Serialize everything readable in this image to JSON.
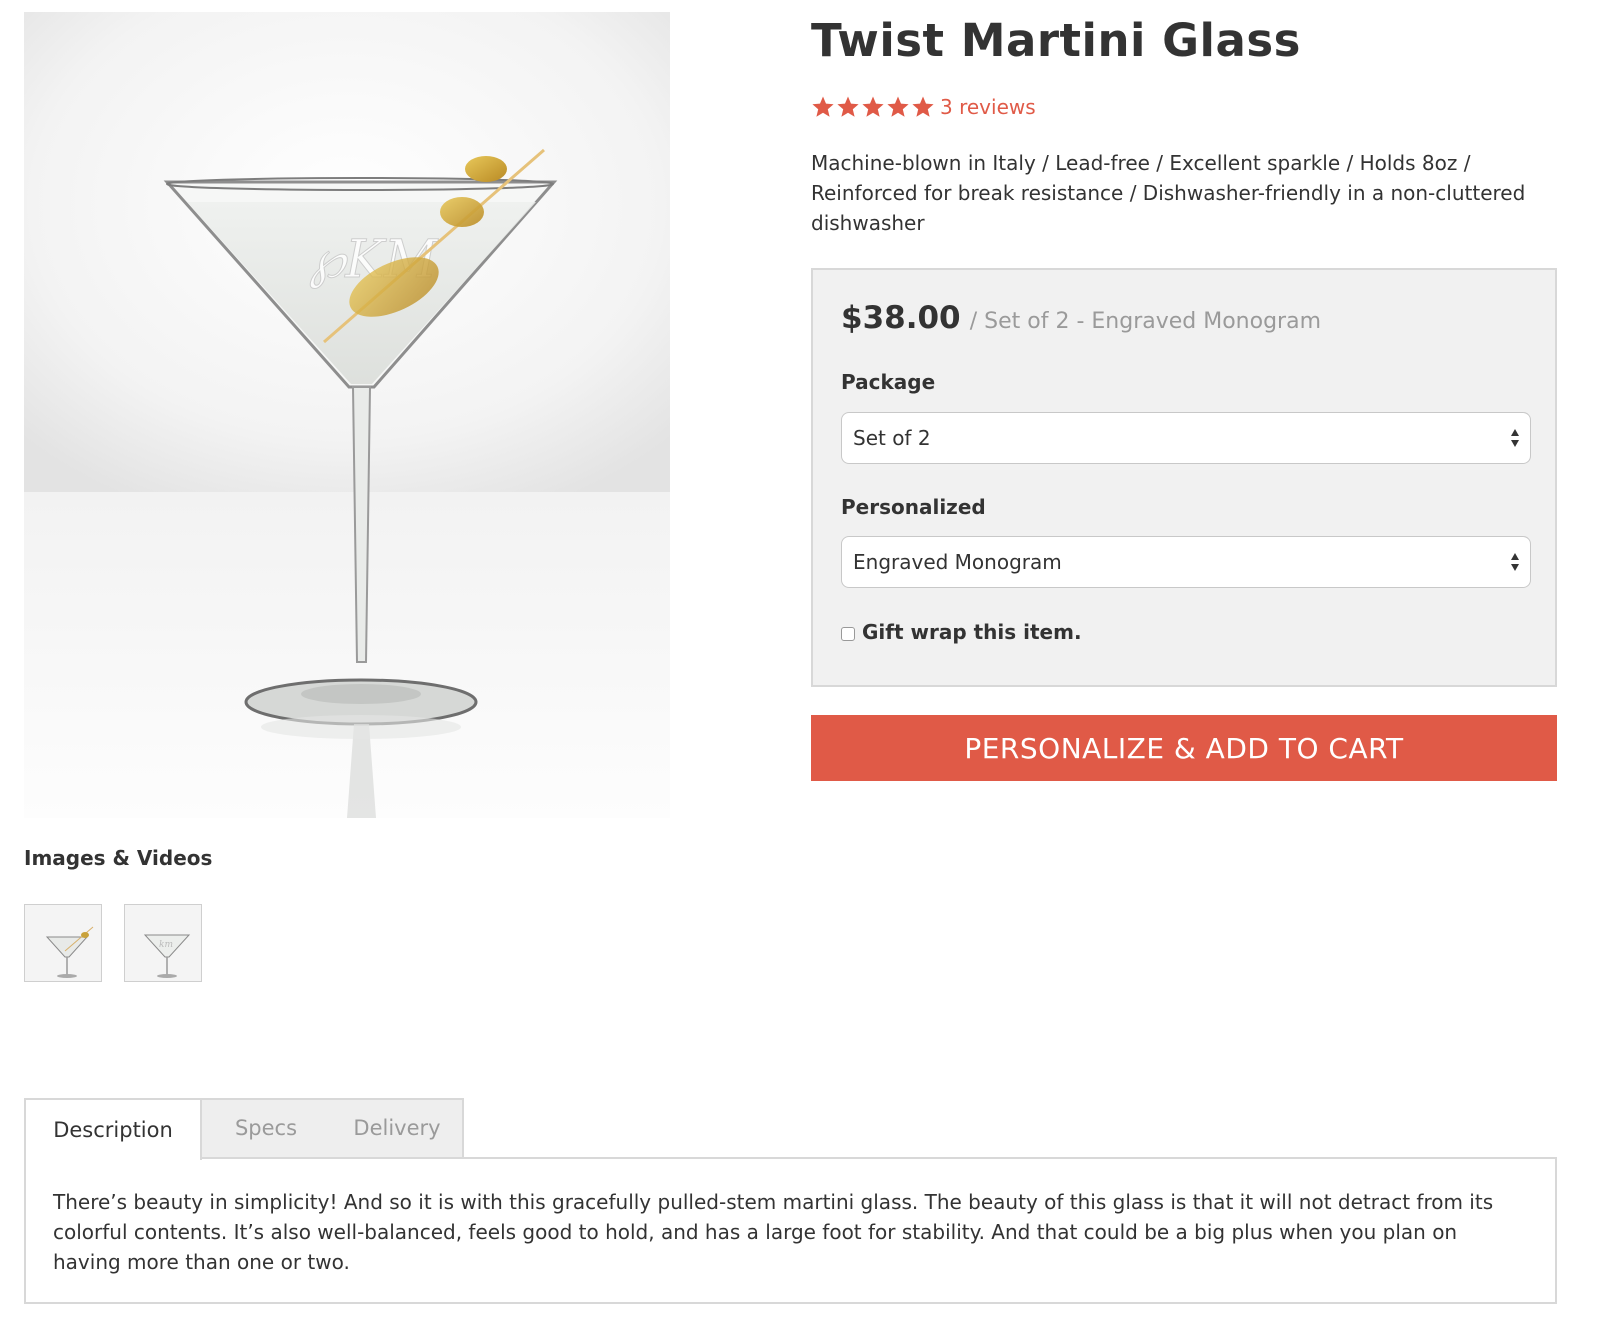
{
  "product": {
    "title": "Twist Martini Glass",
    "rating_stars": 5,
    "reviews_label": "3 reviews",
    "tagline": "Machine-blown in Italy / Lead-free / Excellent sparkle / Holds 8oz / Reinforced for break resistance / Dishwasher-friendly in a non-cluttered dishwasher"
  },
  "gallery": {
    "heading": "Images & Videos",
    "thumbnails": [
      "martini-glass-with-olives",
      "martini-glass-engraved"
    ]
  },
  "options": {
    "price": "$38.00",
    "price_variant": "/ Set of 2 - Engraved Monogram",
    "package_label": "Package",
    "package_value": "Set of 2",
    "personalized_label": "Personalized",
    "personalized_value": "Engraved Monogram",
    "giftwrap_label": "Gift wrap this item.",
    "giftwrap_checked": false
  },
  "cart_button": "PERSONALIZE & ADD TO CART",
  "tabs": {
    "items": [
      "Description",
      "Specs",
      "Delivery"
    ],
    "active": "Description",
    "description_text": "There’s beauty in simplicity! And so it is with this gracefully pulled-stem martini glass. The beauty of this glass is that it will not detract from its colorful contents. It’s also well-balanced, feels good to hold, and has a large foot for stability. And that could be a big plus when you plan on having more than one or two."
  },
  "colors": {
    "accent": "#e05a47",
    "panel_bg": "#f1f1f1",
    "border": "#d8d8d8",
    "text": "#333333",
    "muted": "#9a9a9a"
  },
  "icons": {
    "star": "star-icon",
    "select_arrows": "select-arrows-icon"
  }
}
